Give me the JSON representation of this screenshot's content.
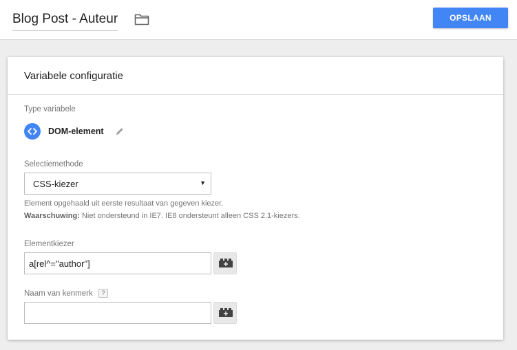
{
  "header": {
    "title": "Blog Post - Auteur",
    "save_label": "OPSLAAN"
  },
  "card": {
    "title": "Variabele configuratie",
    "type_label": "Type variabele",
    "type_name": "DOM-element",
    "selection_label": "Selectiemethode",
    "selection_value": "CSS-kiezer",
    "help_line1": "Element opgehaald uit eerste resultaat van gegeven kiezer.",
    "help_warning_label": "Waarschuwing:",
    "help_warning_text": " Niet ondersteund in IE7. IE8 ondersteunt alleen CSS 2.1-kiezers.",
    "selector_label": "Elementkiezer",
    "selector_value": "a[rel^=\"author\"]",
    "attribute_label": "Naam van kenmerk",
    "attribute_help": "?",
    "attribute_value": ""
  },
  "colors": {
    "accent": "#4285f4",
    "background": "#eeeeee"
  },
  "icons": {
    "folder": "folder-icon",
    "type": "code-brackets-icon",
    "edit": "pencil-icon",
    "variable": "lego-brick-plus-icon"
  }
}
